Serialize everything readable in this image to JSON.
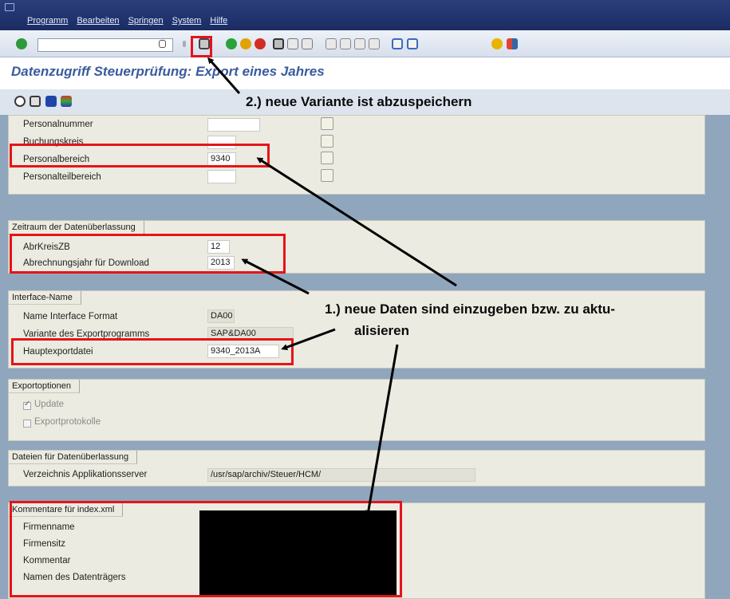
{
  "menu": {
    "items": [
      "Programm",
      "Bearbeiten",
      "Springen",
      "System",
      "Hilfe"
    ]
  },
  "page_title": "Datenzugriff Steuerprüfung: Export eines Jahres",
  "selection": {
    "rows": [
      {
        "label": "Personalnummer",
        "value": ""
      },
      {
        "label": "Buchungskreis",
        "value": ""
      },
      {
        "label": "Personalbereich",
        "value": "9340"
      },
      {
        "label": "Personalteilbereich",
        "value": ""
      }
    ]
  },
  "zeitraum": {
    "title": "Zeitraum der Datenüberlassung",
    "rows": [
      {
        "label": "AbrKreisZB",
        "value": "12"
      },
      {
        "label": "Abrechnungsjahr für Download",
        "value": "2013"
      }
    ]
  },
  "interface": {
    "title": "Interface-Name",
    "rows": [
      {
        "label": "Name Interface Format",
        "value": "DA00"
      },
      {
        "label": "Variante des Exportprogramms",
        "value": "SAP&DA00"
      },
      {
        "label": "Hauptexportdatei",
        "value": "9340_2013A"
      }
    ]
  },
  "exportoptionen": {
    "title": "Exportoptionen",
    "update_label": "Update",
    "update_checked": true,
    "protokoll_label": "Exportprotokolle",
    "protokoll_checked": false
  },
  "dateien": {
    "title": "Dateien für Datenüberlassung",
    "label": "Verzeichnis Applikationsserver",
    "value": "/usr/sap/archiv/Steuer/HCM/"
  },
  "kommentare": {
    "title": "Kommentare für index.xml",
    "rows": [
      "Firmenname",
      "Firmensitz",
      "Kommentar",
      "Namen des Datenträgers"
    ]
  },
  "annotations": {
    "save_note": "2.) neue Variante ist abzuspeichern",
    "data_note_line1": "1.) neue Daten sind einzugeben bzw. zu aktu-",
    "data_note_line2": "alisieren"
  },
  "colors": {
    "highlight": "#e5141a",
    "title": "#3b5b9e",
    "menubar": "#1b2c63"
  }
}
